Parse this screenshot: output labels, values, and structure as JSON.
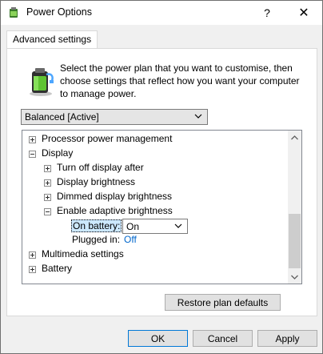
{
  "window": {
    "title": "Power Options",
    "help_glyph": "?",
    "close_glyph": "✕"
  },
  "tabs": [
    {
      "label": "Advanced settings",
      "selected": true
    }
  ],
  "intro_text": "Select the power plan that you want to customise, then choose settings that reflect how you want your computer to manage power.",
  "plan_select": {
    "value": "Balanced [Active]"
  },
  "tree": {
    "items": [
      {
        "label": "Processor power management",
        "expander": "+"
      },
      {
        "label": "Display",
        "expander": "-"
      },
      {
        "label": "Turn off display after",
        "expander": "+"
      },
      {
        "label": "Display brightness",
        "expander": "+"
      },
      {
        "label": "Dimmed display brightness",
        "expander": "+"
      },
      {
        "label": "Enable adaptive brightness",
        "expander": "-"
      },
      {
        "label": "Multimedia settings",
        "expander": "+"
      },
      {
        "label": "Battery",
        "expander": "+"
      }
    ],
    "on_battery": {
      "key": "On battery:",
      "value": "On"
    },
    "plugged_in": {
      "key": "Plugged in:",
      "value": "Off"
    }
  },
  "buttons": {
    "restore": "Restore plan defaults",
    "ok": "OK",
    "cancel": "Cancel",
    "apply": "Apply"
  },
  "colors": {
    "link": "#0066cc",
    "selection": "#cce8ff",
    "default_button_border": "#0078d7"
  }
}
